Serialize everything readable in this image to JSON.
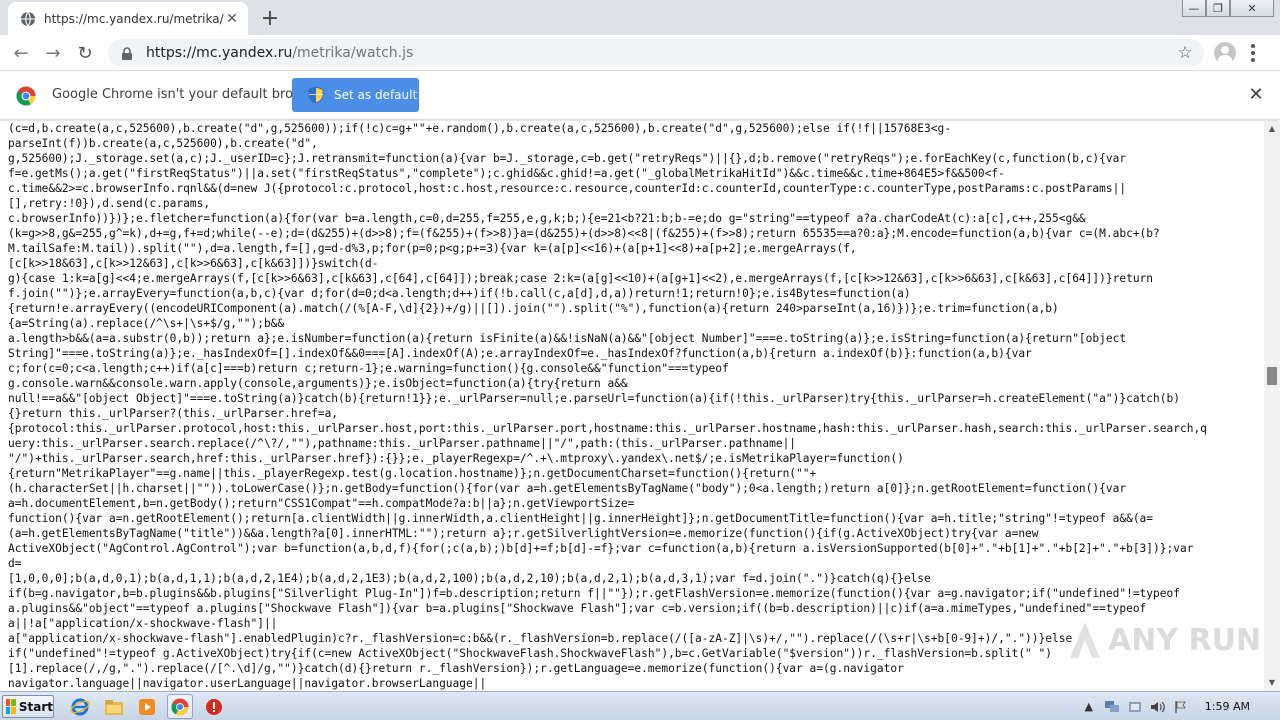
{
  "tab": {
    "title": "https://mc.yandex.ru/metrika/watch.js",
    "close": "✕",
    "new_tab": "+"
  },
  "window_controls": {
    "minimize": "—",
    "restore": "❐",
    "close": "✕"
  },
  "nav": {
    "back": "←",
    "forward": "→",
    "reload": "↻"
  },
  "omnibox": {
    "url_host": "https://mc.yandex.ru",
    "url_path": "/metrika/watch.js",
    "star": "☆"
  },
  "infobar": {
    "message": "Google Chrome isn't your default browser",
    "button": "Set as default",
    "close": "✕"
  },
  "code_lines": [
    "(c=d,b.create(a,c,525600),b.create(\"d\",g,525600));if(!c)c=g+\"\"+e.random(),b.create(a,c,525600),b.create(\"d\",g,525600);else if(!f||15768E3<g-",
    "parseInt(f))b.create(a,c,525600),b.create(\"d\",",
    "g,525600);J._storage.set(a,c);J._userID=c};J.retransmit=function(a){var b=J._storage,c=b.get(\"retryReqs\")||{},d;b.remove(\"retryReqs\");e.forEachKey(c,function(b,c){var",
    "f=e.getMs();a.get(\"firstReqStatus\")||a.set(\"firstReqStatus\",\"complete\");c.ghid&&c.ghid!=a.get(\"_globalMetrikaHitId\")&&c.time&&c.time+864E5>f&&500<f-",
    "c.time&&2>=c.browserInfo.rqnl&&(d=new J({protocol:c.protocol,host:c.host,resource:c.resource,counterId:c.counterId,counterType:c.counterType,postParams:c.postParams||",
    "[],retry:!0}),d.send(c.params,",
    "c.browserInfo))})};e.fletcher=function(a){for(var b=a.length,c=0,d=255,f=255,e,g,k;b;){e=21<b?21:b;b-=e;do g=\"string\"==typeof a?a.charCodeAt(c):a[c],c++,255<g&&",
    "(k=g>>8,g&=255,g^=k),d+=g,f+=d;while(--e);d=(d&255)+(d>>8);f=(f&255)+(f>>8)}a=(d&255)+(d>>8)<<8|(f&255)+(f>>8);return 65535==a?0:a};M.encode=function(a,b){var c=(M.abc+(b?",
    "M.tailSafe:M.tail)).split(\"\"),d=a.length,f=[],g=d-d%3,p;for(p=0;p<g;p+=3){var k=(a[p]<<16)+(a[p+1]<<8)+a[p+2];e.mergeArrays(f,",
    "[c[k>>18&63],c[k>>12&63],c[k>>6&63],c[k&63]])}switch(d-",
    "g){case 1:k=a[g]<<4;e.mergeArrays(f,[c[k>>6&63],c[k&63],c[64],c[64]]);break;case 2:k=(a[g]<<10)+(a[g+1]<<2),e.mergeArrays(f,[c[k>>12&63],c[k>>6&63],c[k&63],c[64]])}return",
    "f.join(\"\")};e.arrayEvery=function(a,b,c){var d;for(d=0;d<a.length;d++)if(!b.call(c,a[d],d,a))return!1;return!0};e.is4Bytes=function(a)",
    "{return!e.arrayEvery((encodeURIComponent(a).match(/(%[A-F,\\d]{2})+/g)||[]).join(\"\").split(\"%\"),function(a){return 240>parseInt(a,16)})};e.trim=function(a,b)",
    "{a=String(a).replace(/^\\s+|\\s+$/g,\"\");b&&",
    "a.length>b&&(a=a.substr(0,b));return a};e.isNumber=function(a){return isFinite(a)&&!isNaN(a)&&\"[object Number]\"===e.toString(a)};e.isString=function(a){return\"[object",
    "String]\"===e.toString(a)};e._hasIndexOf=[].indexOf&&0===[A].indexOf(A);e.arrayIndexOf=e._hasIndexOf?function(a,b){return a.indexOf(b)}:function(a,b){var",
    "c;for(c=0;c<a.length;c++)if(a[c]===b)return c;return-1};e.warning=function(){g.console&&\"function\"===typeof",
    "g.console.warn&&console.warn.apply(console,arguments)};e.isObject=function(a){try{return a&&",
    "null!==a&&\"[object Object]\"===e.toString(a)}catch(b){return!1}};e._urlParser=null;e.parseUrl=function(a){if(!this._urlParser)try{this._urlParser=h.createElement(\"a\")}catch(b)",
    "{}return this._urlParser?(this._urlParser.href=a,",
    "{protocol:this._urlParser.protocol,host:this._urlParser.host,port:this._urlParser.port,hostname:this._urlParser.hostname,hash:this._urlParser.hash,search:this._urlParser.search,q",
    "uery:this._urlParser.search.replace(/^\\?/,\"\"),pathname:this._urlParser.pathname||\"/\",path:(this._urlParser.pathname||",
    "\"/\")+this._urlParser.search,href:this._urlParser.href}):{}};e._playerRegexp=/^.+\\.mtproxy\\.yandex\\.net$/;e.isMetrikaPlayer=function()",
    "{return\"MetrikaPlayer\"==g.name||this._playerRegexp.test(g.location.hostname)};n.getDocumentCharset=function(){return(\"\"+",
    "(h.characterSet||h.charset||\"\")).toLowerCase()};n.getBody=function(){for(var a=h.getElementsByTagName(\"body\");0<a.length;)return a[0]};n.getRootElement=function(){var",
    "a=h.documentElement,b=n.getBody();return\"CSS1Compat\"==h.compatMode?a:b||a};n.getViewportSize=",
    "function(){var a=n.getRootElement();return[a.clientWidth||g.innerWidth,a.clientHeight||g.innerHeight]};n.getDocumentTitle=function(){var a=h.title;\"string\"!=typeof a&&(a=",
    "(a=h.getElementsByTagName(\"title\"))&&a.length?a[0].innerHTML:\"\");return a};r.getSilverlightVersion=e.memorize(function(){if(g.ActiveXObject)try{var a=new",
    "ActiveXObject(\"AgControl.AgControl\");var b=function(a,b,d,f){for(;c(a,b);)b[d]+=f;b[d]-=f};var c=function(a,b){return a.isVersionSupported(b[0]+\".\"+b[1]+\".\"+b[2]+\".\"+b[3])};var",
    "d=",
    "[1,0,0,0];b(a,d,0,1);b(a,d,1,1);b(a,d,2,1E4);b(a,d,2,1E3);b(a,d,2,100);b(a,d,2,10);b(a,d,2,1);b(a,d,3,1);var f=d.join(\".\")}catch(q){}else",
    "if(b=g.navigator,b=b.plugins&&b.plugins[\"Silverlight Plug-In\"])f=b.description;return f||\"\"});r.getFlashVersion=e.memorize(function(){var a=g.navigator;if(\"undefined\"!=typeof",
    "a.plugins&&\"object\"==typeof a.plugins[\"Shockwave Flash\"]){var b=a.plugins[\"Shockwave Flash\"];var c=b.version;if((b=b.description)||c)if(a=a.mimeTypes,\"undefined\"==typeof",
    "a||!a[\"application/x-shockwave-flash\"]||",
    "a[\"application/x-shockwave-flash\"].enabledPlugin)c?r._flashVersion=c:b&&(r._flashVersion=b.replace(/([a-zA-Z]|\\s)+/,\"\").replace(/(\\s+r|\\s+b[0-9]+)/,\".\"))}else",
    "if(\"undefined\"!=typeof g.ActiveXObject)try{if(c=new ActiveXObject(\"ShockwaveFlash.ShockwaveFlash\"),b=c.GetVariable(\"$version\"))r._flashVersion=b.split(\" \")",
    "[1].replace(/,/g,\".\").replace(/[^.\\d]/g,\"\")}catch(d){}return r._flashVersion});r.getLanguage=e.memorize(function(){var a=(g.navigator",
    "navigator.language||navigator.userLanguage||navigator.browserLanguage||"
  ],
  "watermark": "ANY RUN",
  "taskbar": {
    "start_label": "Start",
    "clock": "1:59 AM"
  },
  "colors": {
    "tab_strip": "#dee1e6",
    "set_default_button": "#4a8ee8",
    "omnibox_bg": "#f1f3f4"
  }
}
